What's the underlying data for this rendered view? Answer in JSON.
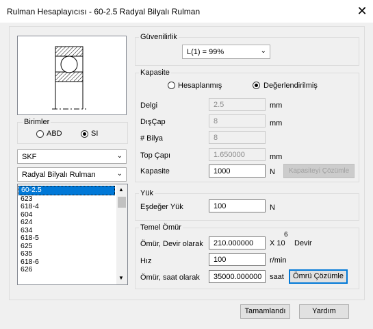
{
  "window": {
    "title": "Rulman Hesaplayıcısı - 60-2.5 Radyal Bilyalı Rulman",
    "close_glyph": "✕"
  },
  "units": {
    "label": "Birimler",
    "options": [
      {
        "label": "ABD",
        "selected": false
      },
      {
        "label": "SI",
        "selected": true
      }
    ]
  },
  "manufacturer": {
    "value": "SKF"
  },
  "bearing_type": {
    "value": "Radyal Bilyalı Rulman"
  },
  "bearing_list": {
    "items": [
      "60-2.5",
      "623",
      "618-4",
      "604",
      "624",
      "634",
      "618-5",
      "625",
      "635",
      "618-6",
      "626"
    ],
    "selected_index": 0
  },
  "reliability": {
    "label": "Güvenilirlik",
    "value": "L(1) = 99%"
  },
  "capacity": {
    "label": "Kapasite",
    "options": [
      {
        "label": "Hesaplanmış",
        "selected": false
      },
      {
        "label": "Değerlendirilmiş",
        "selected": true
      }
    ],
    "bore_label": "Delgi",
    "bore_value": "2.5",
    "bore_unit": "mm",
    "od_label": "DışÇap",
    "od_value": "8",
    "od_unit": "mm",
    "balls_label": "# Bilya",
    "balls_value": "8",
    "ball_dia_label": "Top Çapı",
    "ball_dia_value": "1.650000",
    "ball_dia_unit": "mm",
    "capacity_label": "Kapasite",
    "capacity_value": "1000",
    "capacity_unit": "N",
    "solve_button": "Kapasiteyi Çözümle"
  },
  "load": {
    "label": "Yük",
    "eq_label": "Eşdeğer Yük",
    "eq_value": "100",
    "eq_unit": "N"
  },
  "life": {
    "label": "Temel Ömür",
    "rev_label": "Ömür, Devir olarak",
    "rev_value": "210.000000",
    "rev_unit_prefix": "X 10",
    "rev_unit_exp": "6",
    "rev_unit_suffix": "Devir",
    "speed_label": "Hız",
    "speed_value": "100",
    "speed_unit": "r/min",
    "hours_label": "Ömür, saat olarak",
    "hours_value": "35000.000000",
    "hours_unit": "saat",
    "solve_button": "Ömrü Çözümle"
  },
  "footer": {
    "done_button": "Tamamlandı",
    "help_button": "Yardım"
  },
  "icons": {
    "scroll_up": "▲",
    "scroll_down": "▼",
    "dropdown": "⌄"
  }
}
